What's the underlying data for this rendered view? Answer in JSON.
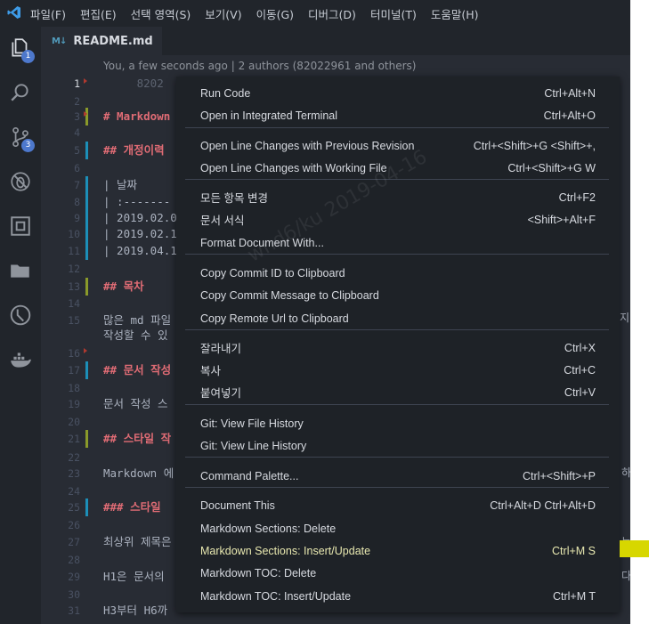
{
  "menubar": [
    "파일(F)",
    "편집(E)",
    "선택 영역(S)",
    "보기(V)",
    "이동(G)",
    "디버그(D)",
    "터미널(T)",
    "도움말(H)"
  ],
  "activity": {
    "explorer_badge": "1",
    "scm_badge": "3"
  },
  "tab": {
    "icon_text": "M↓",
    "label": "README.md"
  },
  "blame": "You, a few seconds ago | 2 authors (82022961 and others)",
  "lines": [
    {
      "n": "1",
      "text": "     8202"
    },
    {
      "n": "2",
      "text": ""
    },
    {
      "n": "3",
      "text": "# Markdown"
    },
    {
      "n": "4",
      "text": ""
    },
    {
      "n": "5",
      "text": "## 개정이력"
    },
    {
      "n": "6",
      "text": ""
    },
    {
      "n": "7",
      "text": "| 날짜"
    },
    {
      "n": "8",
      "text": "| :-------"
    },
    {
      "n": "9",
      "text": "| 2019.02.0"
    },
    {
      "n": "10",
      "text": "| 2019.02.1"
    },
    {
      "n": "11",
      "text": "| 2019.04.1"
    },
    {
      "n": "12",
      "text": ""
    },
    {
      "n": "13",
      "text": "## 목차"
    },
    {
      "n": "14",
      "text": ""
    },
    {
      "n": "15",
      "text": "많은 md 파일"
    },
    {
      "n": "",
      "text": "작성할 수 있"
    },
    {
      "n": "16",
      "text": ""
    },
    {
      "n": "17",
      "text": "## 문서 작성"
    },
    {
      "n": "18",
      "text": ""
    },
    {
      "n": "19",
      "text": "문서 작성 스"
    },
    {
      "n": "20",
      "text": ""
    },
    {
      "n": "21",
      "text": "## 스타일 작"
    },
    {
      "n": "22",
      "text": ""
    },
    {
      "n": "23",
      "text": "Markdown 에"
    },
    {
      "n": "24",
      "text": ""
    },
    {
      "n": "25",
      "text": "### 스타일"
    },
    {
      "n": "26",
      "text": ""
    },
    {
      "n": "27",
      "text": "최상위 제목은"
    },
    {
      "n": "28",
      "text": ""
    },
    {
      "n": "29",
      "text": "H1은 문서의"
    },
    {
      "n": "30",
      "text": ""
    },
    {
      "n": "31",
      "text": "H3부터 H6까"
    }
  ],
  "right_fragments": [
    "지",
    "하",
    "는",
    "다"
  ],
  "watermark": "wnd6/ku    2019-04-16",
  "context_menu": [
    {
      "label": "Run Code",
      "key": "Ctrl+Alt+N"
    },
    {
      "label": "Open in Integrated Terminal",
      "key": "Ctrl+Alt+O"
    },
    {
      "label": "Open Line Changes with Previous Revision",
      "key": "Ctrl+<Shift>+G <Shift>+,"
    },
    {
      "label": "Open Line Changes with Working File",
      "key": "Ctrl+<Shift>+G W"
    },
    {
      "label": "모든 항목 변경",
      "key": "Ctrl+F2"
    },
    {
      "label": "문서 서식",
      "key": "<Shift>+Alt+F"
    },
    {
      "label": "Format Document With...",
      "key": ""
    },
    {
      "label": "Copy Commit ID to Clipboard",
      "key": ""
    },
    {
      "label": "Copy Commit Message to Clipboard",
      "key": ""
    },
    {
      "label": "Copy Remote Url to Clipboard",
      "key": ""
    },
    {
      "label": "잘라내기",
      "key": "Ctrl+X"
    },
    {
      "label": "복사",
      "key": "Ctrl+C"
    },
    {
      "label": "붙여넣기",
      "key": "Ctrl+V"
    },
    {
      "label": "Git: View File History",
      "key": ""
    },
    {
      "label": "Git: View Line History",
      "key": ""
    },
    {
      "label": "Command Palette...",
      "key": "Ctrl+<Shift>+P"
    },
    {
      "label": "Document This",
      "key": "Ctrl+Alt+D Ctrl+Alt+D"
    },
    {
      "label": "Markdown Sections: Delete",
      "key": ""
    },
    {
      "label": "Markdown Sections: Insert/Update",
      "key": "Ctrl+M S"
    },
    {
      "label": "Markdown TOC: Delete",
      "key": ""
    },
    {
      "label": "Markdown TOC: Insert/Update",
      "key": "Ctrl+M T"
    }
  ],
  "colors": {
    "accent": "#4d78cc",
    "heading": "#e06c75",
    "highlight": "#d7d700"
  }
}
